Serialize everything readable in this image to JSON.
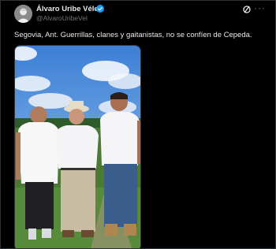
{
  "post": {
    "author_name": "Álvaro Uribe Vélez",
    "author_handle": "@AlvaroUribeVel",
    "text": "Segovia, Ant. Guerrillas, clanes y gaitanistas, no se confíen de Cepeda.",
    "more_label": "···"
  },
  "icons": {
    "verified": "verified-badge-icon",
    "grok": "grok-icon",
    "more": "more-options-icon"
  },
  "colors": {
    "background": "#000000",
    "text": "#e7e9ea",
    "muted": "#71767b",
    "verified": "#1d9bf0"
  }
}
